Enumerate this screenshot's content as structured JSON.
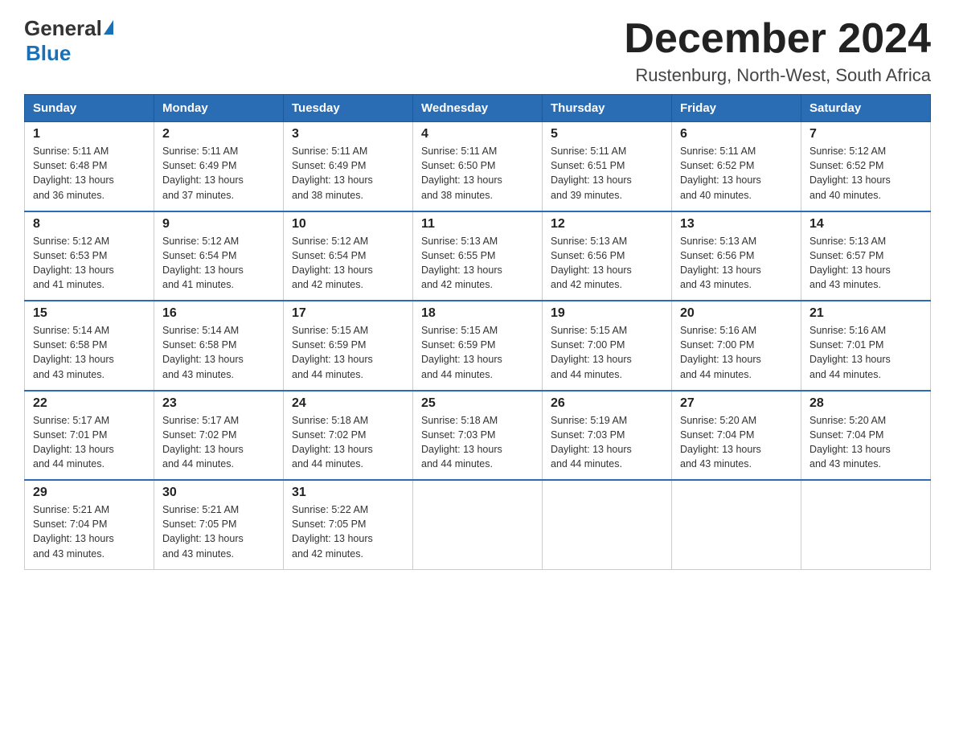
{
  "logo": {
    "general": "General",
    "blue": "Blue"
  },
  "title": "December 2024",
  "location": "Rustenburg, North-West, South Africa",
  "weekdays": [
    "Sunday",
    "Monday",
    "Tuesday",
    "Wednesday",
    "Thursday",
    "Friday",
    "Saturday"
  ],
  "weeks": [
    [
      {
        "day": "1",
        "sunrise": "5:11 AM",
        "sunset": "6:48 PM",
        "daylight": "13 hours and 36 minutes."
      },
      {
        "day": "2",
        "sunrise": "5:11 AM",
        "sunset": "6:49 PM",
        "daylight": "13 hours and 37 minutes."
      },
      {
        "day": "3",
        "sunrise": "5:11 AM",
        "sunset": "6:49 PM",
        "daylight": "13 hours and 38 minutes."
      },
      {
        "day": "4",
        "sunrise": "5:11 AM",
        "sunset": "6:50 PM",
        "daylight": "13 hours and 38 minutes."
      },
      {
        "day": "5",
        "sunrise": "5:11 AM",
        "sunset": "6:51 PM",
        "daylight": "13 hours and 39 minutes."
      },
      {
        "day": "6",
        "sunrise": "5:11 AM",
        "sunset": "6:52 PM",
        "daylight": "13 hours and 40 minutes."
      },
      {
        "day": "7",
        "sunrise": "5:12 AM",
        "sunset": "6:52 PM",
        "daylight": "13 hours and 40 minutes."
      }
    ],
    [
      {
        "day": "8",
        "sunrise": "5:12 AM",
        "sunset": "6:53 PM",
        "daylight": "13 hours and 41 minutes."
      },
      {
        "day": "9",
        "sunrise": "5:12 AM",
        "sunset": "6:54 PM",
        "daylight": "13 hours and 41 minutes."
      },
      {
        "day": "10",
        "sunrise": "5:12 AM",
        "sunset": "6:54 PM",
        "daylight": "13 hours and 42 minutes."
      },
      {
        "day": "11",
        "sunrise": "5:13 AM",
        "sunset": "6:55 PM",
        "daylight": "13 hours and 42 minutes."
      },
      {
        "day": "12",
        "sunrise": "5:13 AM",
        "sunset": "6:56 PM",
        "daylight": "13 hours and 42 minutes."
      },
      {
        "day": "13",
        "sunrise": "5:13 AM",
        "sunset": "6:56 PM",
        "daylight": "13 hours and 43 minutes."
      },
      {
        "day": "14",
        "sunrise": "5:13 AM",
        "sunset": "6:57 PM",
        "daylight": "13 hours and 43 minutes."
      }
    ],
    [
      {
        "day": "15",
        "sunrise": "5:14 AM",
        "sunset": "6:58 PM",
        "daylight": "13 hours and 43 minutes."
      },
      {
        "day": "16",
        "sunrise": "5:14 AM",
        "sunset": "6:58 PM",
        "daylight": "13 hours and 43 minutes."
      },
      {
        "day": "17",
        "sunrise": "5:15 AM",
        "sunset": "6:59 PM",
        "daylight": "13 hours and 44 minutes."
      },
      {
        "day": "18",
        "sunrise": "5:15 AM",
        "sunset": "6:59 PM",
        "daylight": "13 hours and 44 minutes."
      },
      {
        "day": "19",
        "sunrise": "5:15 AM",
        "sunset": "7:00 PM",
        "daylight": "13 hours and 44 minutes."
      },
      {
        "day": "20",
        "sunrise": "5:16 AM",
        "sunset": "7:00 PM",
        "daylight": "13 hours and 44 minutes."
      },
      {
        "day": "21",
        "sunrise": "5:16 AM",
        "sunset": "7:01 PM",
        "daylight": "13 hours and 44 minutes."
      }
    ],
    [
      {
        "day": "22",
        "sunrise": "5:17 AM",
        "sunset": "7:01 PM",
        "daylight": "13 hours and 44 minutes."
      },
      {
        "day": "23",
        "sunrise": "5:17 AM",
        "sunset": "7:02 PM",
        "daylight": "13 hours and 44 minutes."
      },
      {
        "day": "24",
        "sunrise": "5:18 AM",
        "sunset": "7:02 PM",
        "daylight": "13 hours and 44 minutes."
      },
      {
        "day": "25",
        "sunrise": "5:18 AM",
        "sunset": "7:03 PM",
        "daylight": "13 hours and 44 minutes."
      },
      {
        "day": "26",
        "sunrise": "5:19 AM",
        "sunset": "7:03 PM",
        "daylight": "13 hours and 44 minutes."
      },
      {
        "day": "27",
        "sunrise": "5:20 AM",
        "sunset": "7:04 PM",
        "daylight": "13 hours and 43 minutes."
      },
      {
        "day": "28",
        "sunrise": "5:20 AM",
        "sunset": "7:04 PM",
        "daylight": "13 hours and 43 minutes."
      }
    ],
    [
      {
        "day": "29",
        "sunrise": "5:21 AM",
        "sunset": "7:04 PM",
        "daylight": "13 hours and 43 minutes."
      },
      {
        "day": "30",
        "sunrise": "5:21 AM",
        "sunset": "7:05 PM",
        "daylight": "13 hours and 43 minutes."
      },
      {
        "day": "31",
        "sunrise": "5:22 AM",
        "sunset": "7:05 PM",
        "daylight": "13 hours and 42 minutes."
      },
      null,
      null,
      null,
      null
    ]
  ],
  "labels": {
    "sunrise": "Sunrise:",
    "sunset": "Sunset:",
    "daylight": "Daylight:"
  }
}
